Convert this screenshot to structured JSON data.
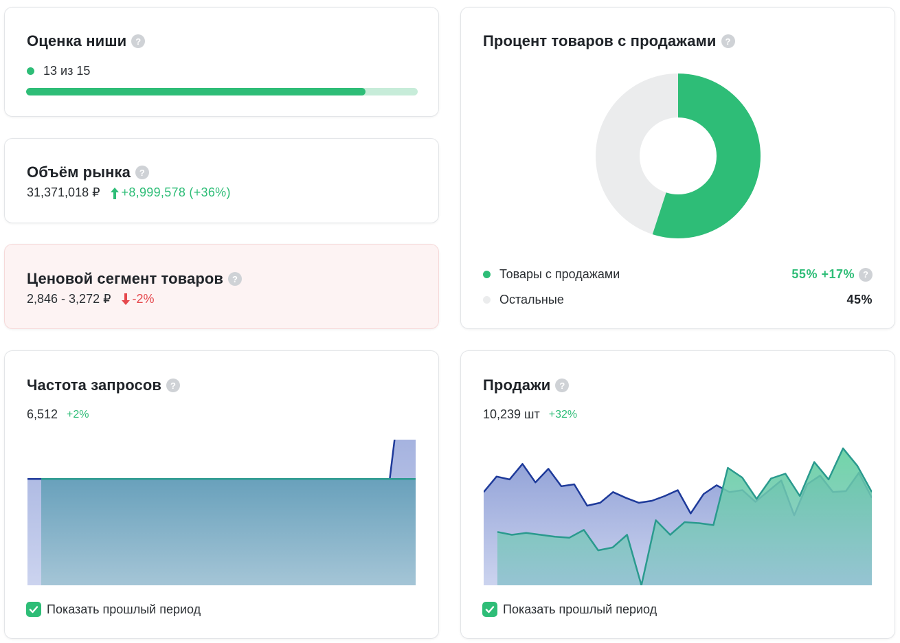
{
  "niche": {
    "title": "Оценка ниши",
    "score_text": "13 из 15",
    "score_fraction": 0.867,
    "color": "#2ebd77"
  },
  "market": {
    "title": "Объём рынка",
    "value": "31,371,018 ₽",
    "change": "+8,999,578 (+36%)",
    "change_icon": "arrow-up-icon"
  },
  "price": {
    "title": "Ценовой сегмент товаров",
    "value": "2,846 - 3,272 ₽",
    "change": "-2%",
    "change_icon": "arrow-down-icon"
  },
  "percent": {
    "title": "Процент товаров с продажами",
    "legend": [
      {
        "label": "Товары с продажами",
        "value": "55% +17%",
        "color": "#2ebd77",
        "share": 55
      },
      {
        "label": "Остальные",
        "value": "45%",
        "color": "#ebeced",
        "share": 45
      }
    ]
  },
  "requests": {
    "title": "Частота запросов",
    "value": "6,512",
    "change": "+2%",
    "checkbox_label": "Показать прошлый период",
    "checked": true,
    "chart_data": {
      "type": "area",
      "series": [
        {
          "values": [
            1,
            1,
            1,
            1,
            1,
            1,
            1,
            1,
            1,
            1,
            1,
            1,
            1,
            1,
            1,
            1,
            1,
            1,
            1,
            1,
            1,
            1,
            1,
            1,
            1,
            1,
            1,
            1,
            1,
            2,
            2
          ],
          "color": "#1e3a9a"
        },
        {
          "values": [
            1,
            1,
            1,
            1,
            1,
            1,
            1,
            1,
            1,
            1,
            1,
            1,
            1,
            1,
            1,
            1,
            1,
            1,
            1,
            1,
            1,
            1,
            1,
            1,
            1,
            1,
            1,
            1,
            1,
            1
          ],
          "color": "#2a9a8e"
        }
      ],
      "ylim": [
        0,
        1.37
      ]
    }
  },
  "sales": {
    "title": "Продажи",
    "value": "10,239 шт",
    "change": "+32%",
    "checkbox_label": "Показать прошлый период",
    "checked": true,
    "chart_data": {
      "type": "area",
      "series": [
        {
          "values": [
            96,
            112,
            109,
            125,
            106,
            120,
            102,
            104,
            82,
            85,
            96,
            90,
            85,
            87,
            92,
            98,
            74,
            94,
            103,
            96,
            98,
            86,
            97,
            108,
            72,
            104,
            113,
            96,
            97,
            116,
            90
          ],
          "color": "#1e3a9a"
        },
        {
          "values": [
            55,
            52,
            54,
            52,
            50,
            49,
            57,
            36,
            39,
            52,
            0,
            67,
            52,
            65,
            64,
            62,
            121,
            111,
            89,
            110,
            115,
            92,
            127,
            109,
            141,
            123,
            96
          ],
          "color": "#2a9a8e"
        }
      ],
      "ylim": [
        0,
        150
      ]
    }
  }
}
